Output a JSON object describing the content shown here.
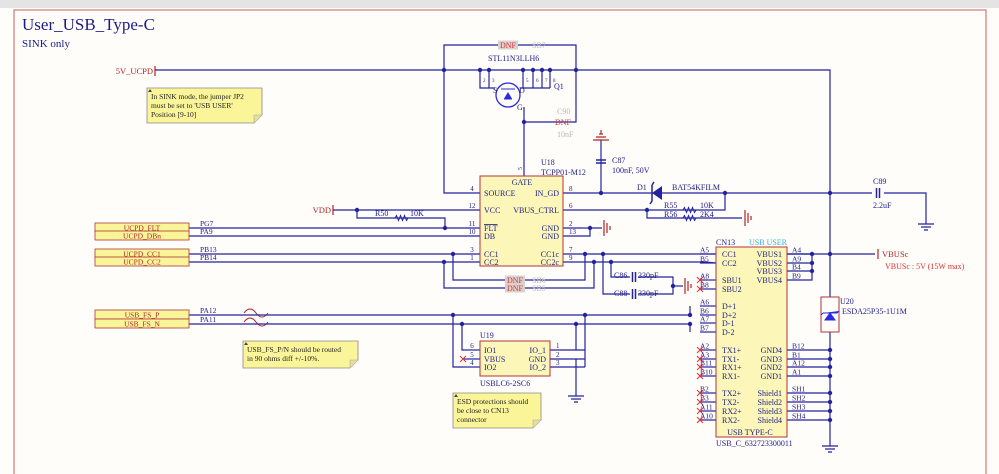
{
  "sheet": {
    "title": "User_USB_Type-C",
    "subtitle": "SINK only"
  },
  "colors": {
    "wire": "#2323a0",
    "text": "#1c1c86",
    "net_label": "#b0242a",
    "part_fill": "#fcf7b8",
    "part_border": "#b0343a",
    "note_fill": "#fbf59a",
    "dnf_text": "#e03030",
    "usb_user": "#2fb6d8",
    "frame": "#c46060"
  },
  "nets": {
    "v5_ucpd": "5V_UCPD",
    "vdd": "VDD",
    "vbusc": "VBUSc",
    "vbusc_note": "VBUSc : 5V (15W max)"
  },
  "ports": [
    {
      "label": "UCPD_FLT",
      "pin": "PG7"
    },
    {
      "label": "UCPD_DBn",
      "pin": "PA9"
    },
    {
      "label": "UCPD_CC1",
      "pin": "PB13"
    },
    {
      "label": "UCPD_CC2",
      "pin": "PB14"
    },
    {
      "label": "USB_FS_P",
      "pin": "PA12"
    },
    {
      "label": "USB_FS_N",
      "pin": "PA11"
    }
  ],
  "notes": [
    {
      "lines": [
        "In SINK mode, the jumper JP2",
        "must be set to 'USB USER'",
        "Position [9-10]"
      ]
    },
    {
      "lines": [
        "USB_FS_P/N should be routed",
        "in 90 ohms diff +/-10%."
      ]
    },
    {
      "lines": [
        "ESD protections should",
        "be close to CN13",
        "connector"
      ]
    }
  ],
  "q1": {
    "ref": "Q1",
    "part": "STL11N3LLH6",
    "s": "S",
    "d": "D",
    "g": "G",
    "pins_left": [
      "1",
      "2",
      "3"
    ],
    "pins_right": [
      "5",
      "6",
      "7",
      "8"
    ],
    "gate_pin": "4"
  },
  "sb7": {
    "ref": "SB7",
    "dnf": "DNF"
  },
  "c90": {
    "ref": "C90",
    "dnf": "DNF",
    "value": "10nF"
  },
  "u18": {
    "ref": "U18",
    "part": "TCPP01-M12",
    "top": "GATE",
    "top_pin": "5",
    "left": [
      {
        "n": "4",
        "name": "SOURCE"
      },
      {
        "n": "12",
        "name": "VCC"
      },
      {
        "n": "11",
        "name": "FLT"
      },
      {
        "n": "10",
        "name": "DB"
      },
      {
        "n": "3",
        "name": "CC1"
      },
      {
        "n": "1",
        "name": "CC2"
      }
    ],
    "right": [
      {
        "n": "8",
        "name": "IN_GD"
      },
      {
        "n": "6",
        "name": "VBUS_CTRL"
      },
      {
        "n": "2",
        "name": "GND"
      },
      {
        "n": "13",
        "name": "GND"
      },
      {
        "n": "7",
        "name": "CC1c"
      },
      {
        "n": "9",
        "name": "CC2c"
      }
    ]
  },
  "r50": {
    "ref": "R50",
    "value": "10K"
  },
  "r55": {
    "ref": "R55",
    "value": "10K"
  },
  "r56": {
    "ref": "R56",
    "value": "2K4"
  },
  "c87": {
    "ref": "C87",
    "value": "100nF, 50V"
  },
  "c89": {
    "ref": "C89",
    "value": "2.2uF"
  },
  "c86": {
    "ref": "C86",
    "value": "330pF"
  },
  "c88": {
    "ref": "C88",
    "value": "330pF"
  },
  "d1": {
    "ref": "D1",
    "part": "BAT54KFILM"
  },
  "sb6": {
    "ref": "SB6",
    "dnf": "DNF"
  },
  "sb5": {
    "ref": "SB5",
    "dnf": "DNF"
  },
  "u19": {
    "ref": "U19",
    "part": "USBLC6-2SC6",
    "left": [
      {
        "n": "6",
        "name": "IO1"
      },
      {
        "n": "5",
        "name": "VBUS"
      },
      {
        "n": "4",
        "name": "IO2"
      }
    ],
    "right": [
      {
        "n": "1",
        "name": "IO_1"
      },
      {
        "n": "2",
        "name": "GND"
      },
      {
        "n": "3",
        "name": "IO_2"
      }
    ]
  },
  "u20": {
    "ref": "U20",
    "part": "ESDA25P35-1U1M"
  },
  "cn13": {
    "ref": "CN13",
    "tag": "USB USER",
    "bottom": "USB TYPE-C",
    "part": "USB_C_632723300011",
    "left": [
      {
        "n": "A5",
        "name": "CC1"
      },
      {
        "n": "B5",
        "name": "CC2"
      },
      {
        "n": "A8",
        "name": "SBU1"
      },
      {
        "n": "B8",
        "name": "SBU2"
      },
      {
        "n": "A6",
        "name": "D+1"
      },
      {
        "n": "B6",
        "name": "D+2"
      },
      {
        "n": "A7",
        "name": "D-1"
      },
      {
        "n": "B7",
        "name": "D-2"
      },
      {
        "n": "A2",
        "name": "TX1+"
      },
      {
        "n": "A3",
        "name": "TX1-"
      },
      {
        "n": "B11",
        "name": "RX1+"
      },
      {
        "n": "B10",
        "name": "RX1-"
      },
      {
        "n": "B2",
        "name": "TX2+"
      },
      {
        "n": "B3",
        "name": "TX2-"
      },
      {
        "n": "A11",
        "name": "RX2+"
      },
      {
        "n": "A10",
        "name": "RX2-"
      }
    ],
    "right": [
      {
        "n": "A4",
        "name": "VBUS1"
      },
      {
        "n": "A9",
        "name": "VBUS2"
      },
      {
        "n": "B4",
        "name": "VBUS3"
      },
      {
        "n": "B9",
        "name": "VBUS4"
      },
      {
        "n": "B12",
        "name": "GND4"
      },
      {
        "n": "B1",
        "name": "GND3"
      },
      {
        "n": "A12",
        "name": "GND2"
      },
      {
        "n": "A1",
        "name": "GND1"
      },
      {
        "n": "SH1",
        "name": "Shield1"
      },
      {
        "n": "SH2",
        "name": "Shield2"
      },
      {
        "n": "SH3",
        "name": "Shield3"
      },
      {
        "n": "SH4",
        "name": "Shield4"
      }
    ]
  }
}
